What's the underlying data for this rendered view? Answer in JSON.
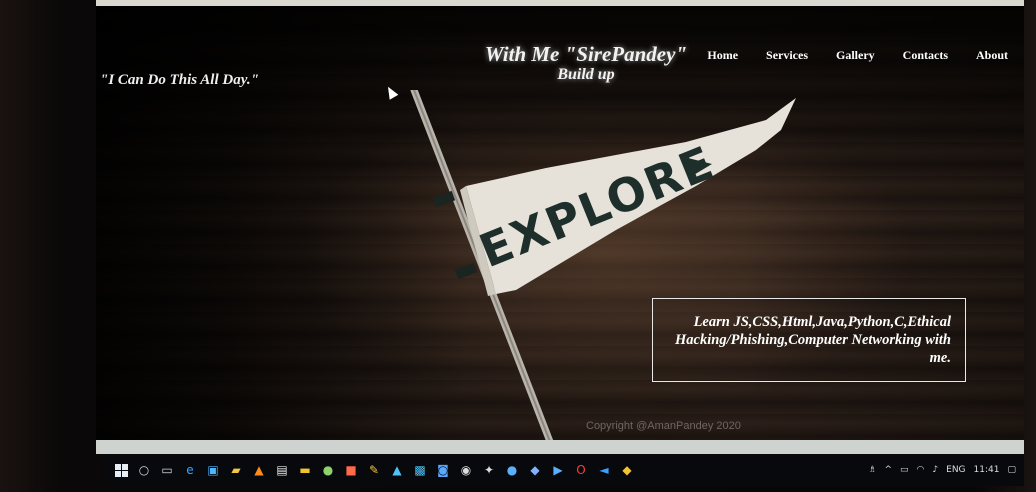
{
  "header": {
    "brand_line1": "With Me \"SirePandey\"",
    "brand_line2": "Build up",
    "nav": [
      {
        "label": "Home"
      },
      {
        "label": "Services"
      },
      {
        "label": "Gallery"
      },
      {
        "label": "Contacts"
      },
      {
        "label": "About"
      }
    ]
  },
  "hero": {
    "quote": "\"I Can Do This All Day.\"",
    "pennant_text": "EXPLORE",
    "info_text": "Learn JS,CSS,Html,Java,Python,C,Ethical Hacking/Phishing,Computer Networking with me."
  },
  "footer": {
    "copyright": "Copyright @AmanPandey 2020"
  },
  "taskbar": {
    "apps": [
      "start-icon",
      "search-circle-icon",
      "task-view-icon",
      "edge-icon",
      "store-icon",
      "folder-icon",
      "vlc-icon",
      "app-icon",
      "app-icon",
      "app-icon",
      "app-icon",
      "app-icon",
      "app-icon",
      "app-icon",
      "app-icon",
      "app-icon",
      "app-icon",
      "app-icon",
      "app-icon",
      "app-icon",
      "opera-icon",
      "vscode-icon",
      "app-icon"
    ],
    "tray": {
      "language": "ENG",
      "time": "11:41"
    }
  },
  "colors": {
    "wood_dark": "#2a1e18",
    "wood_light": "#3a2a21",
    "pennant": "#e8e4dc",
    "pennant_text": "#1e2e2a",
    "text": "#ffffff",
    "taskbar": "#07090c"
  }
}
